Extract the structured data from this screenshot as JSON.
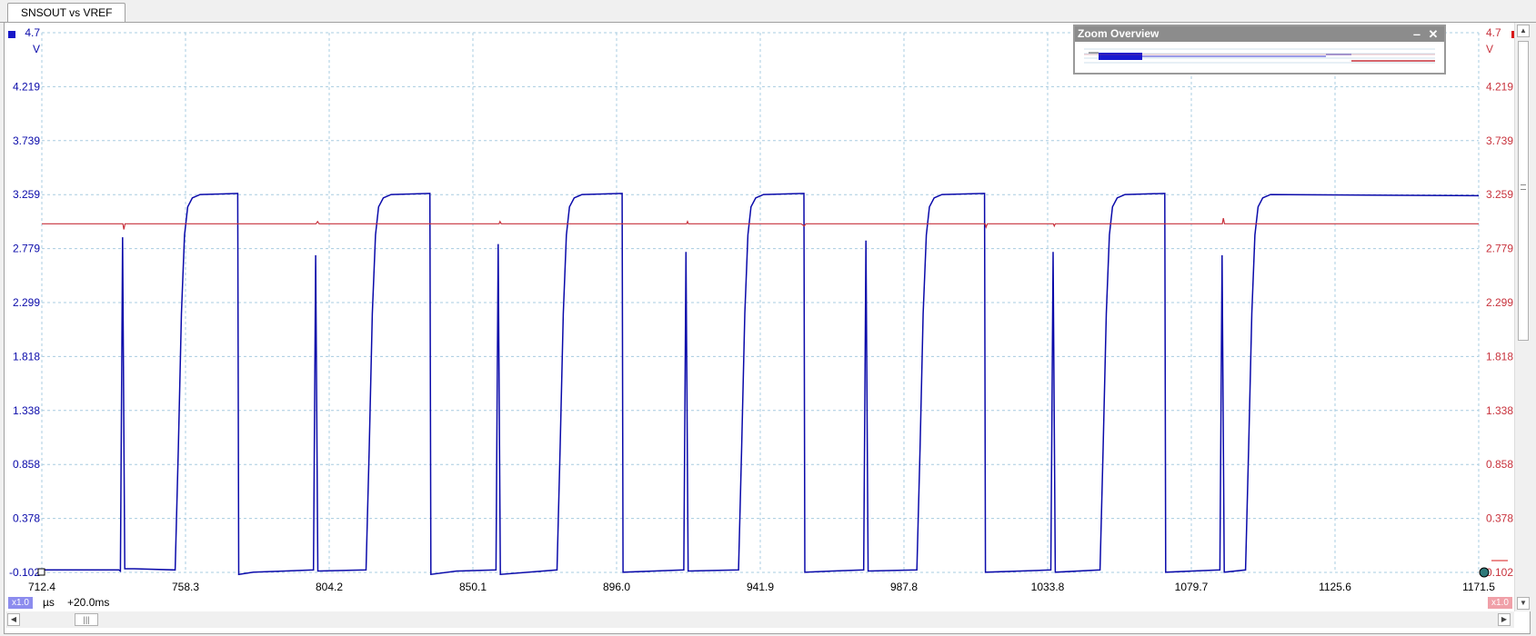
{
  "tab": {
    "label": "SNSOUT vs VREF"
  },
  "zoom_overview": {
    "title": "Zoom Overview",
    "minimize_label": "‒",
    "close_label": "✕"
  },
  "footer": {
    "left_multiplier": "x1.0",
    "right_multiplier": "x1.0",
    "time_unit": "µs",
    "time_offset": "+20.0ms"
  },
  "colors": {
    "blue": "#0a0aaa",
    "red": "#c8323c",
    "grid": "#a8cce0"
  },
  "chart_data": {
    "type": "line",
    "title": "",
    "xlabel": "µs",
    "ylabel": "V",
    "xlim": [
      712.4,
      1171.5
    ],
    "ylim": [
      -0.102,
      4.7
    ],
    "x_ticks": [
      "712.4",
      "758.3",
      "804.2",
      "850.1",
      "896.0",
      "941.9",
      "987.8",
      "1033.8",
      "1079.7",
      "1125.6",
      "1171.5"
    ],
    "y_ticks_left": [
      "4.7",
      "4.219",
      "3.739",
      "3.259",
      "2.779",
      "2.299",
      "1.818",
      "1.338",
      "0.858",
      "0.378",
      "-0.102"
    ],
    "y_ticks_right": [
      "4.7",
      "4.219",
      "3.739",
      "3.259",
      "2.779",
      "2.299",
      "1.818",
      "1.338",
      "0.858",
      "0.378",
      "0.102"
    ],
    "y_unit_left": "V",
    "y_unit_right": "V",
    "grid": true,
    "series": [
      {
        "name": "SNSOUT",
        "color": "#0a0aaa",
        "points": [
          [
            712.4,
            -0.08
          ],
          [
            737.0,
            -0.08
          ],
          [
            737.5,
            -0.09
          ],
          [
            738.2,
            2.88
          ],
          [
            738.9,
            -0.07
          ],
          [
            742.0,
            -0.07
          ],
          [
            755.0,
            -0.08
          ],
          [
            756.0,
            1.0
          ],
          [
            757.0,
            2.2
          ],
          [
            758.0,
            2.9
          ],
          [
            759.0,
            3.15
          ],
          [
            760.5,
            3.23
          ],
          [
            763.0,
            3.26
          ],
          [
            775.0,
            3.27
          ],
          [
            775.3,
            -0.12
          ],
          [
            780.0,
            -0.1
          ],
          [
            790.0,
            -0.09
          ],
          [
            799.2,
            -0.08
          ],
          [
            799.9,
            2.72
          ],
          [
            800.6,
            -0.09
          ],
          [
            816.0,
            -0.08
          ],
          [
            817.0,
            1.0
          ],
          [
            818.0,
            2.2
          ],
          [
            819.0,
            2.9
          ],
          [
            820.0,
            3.15
          ],
          [
            821.5,
            3.23
          ],
          [
            824.0,
            3.26
          ],
          [
            836.4,
            3.27
          ],
          [
            836.7,
            -0.12
          ],
          [
            845.0,
            -0.09
          ],
          [
            857.5,
            -0.08
          ],
          [
            858.2,
            2.82
          ],
          [
            858.9,
            -0.12
          ],
          [
            877.0,
            -0.08
          ],
          [
            878.0,
            1.0
          ],
          [
            879.0,
            2.2
          ],
          [
            880.0,
            2.9
          ],
          [
            881.0,
            3.15
          ],
          [
            882.5,
            3.23
          ],
          [
            885.0,
            3.26
          ],
          [
            897.8,
            3.27
          ],
          [
            898.1,
            -0.1
          ],
          [
            908.0,
            -0.09
          ],
          [
            917.5,
            -0.08
          ],
          [
            918.2,
            2.75
          ],
          [
            918.9,
            -0.09
          ],
          [
            935.0,
            -0.08
          ],
          [
            936.0,
            1.0
          ],
          [
            937.0,
            2.2
          ],
          [
            938.0,
            2.9
          ],
          [
            939.0,
            3.15
          ],
          [
            940.5,
            3.23
          ],
          [
            943.0,
            3.26
          ],
          [
            955.9,
            3.27
          ],
          [
            956.2,
            -0.1
          ],
          [
            965.0,
            -0.09
          ],
          [
            975.0,
            -0.08
          ],
          [
            975.7,
            2.85
          ],
          [
            976.4,
            -0.09
          ],
          [
            992.0,
            -0.08
          ],
          [
            993.0,
            1.0
          ],
          [
            994.0,
            2.2
          ],
          [
            995.0,
            2.9
          ],
          [
            996.0,
            3.15
          ],
          [
            997.5,
            3.23
          ],
          [
            1000.0,
            3.26
          ],
          [
            1013.6,
            3.27
          ],
          [
            1013.9,
            -0.1
          ],
          [
            1025.0,
            -0.09
          ],
          [
            1034.8,
            -0.08
          ],
          [
            1035.5,
            2.75
          ],
          [
            1036.2,
            -0.1
          ],
          [
            1050.5,
            -0.08
          ],
          [
            1051.5,
            1.0
          ],
          [
            1052.5,
            2.2
          ],
          [
            1053.5,
            2.9
          ],
          [
            1054.5,
            3.15
          ],
          [
            1056.0,
            3.23
          ],
          [
            1058.5,
            3.26
          ],
          [
            1071.2,
            3.27
          ],
          [
            1071.5,
            -0.1
          ],
          [
            1080.0,
            -0.09
          ],
          [
            1088.8,
            -0.08
          ],
          [
            1089.5,
            2.72
          ],
          [
            1090.2,
            -0.1
          ],
          [
            1097.0,
            -0.08
          ],
          [
            1098.0,
            1.0
          ],
          [
            1099.0,
            2.2
          ],
          [
            1100.0,
            2.9
          ],
          [
            1101.0,
            3.15
          ],
          [
            1102.5,
            3.23
          ],
          [
            1105.0,
            3.26
          ],
          [
            1171.5,
            3.25
          ]
        ]
      },
      {
        "name": "VREF",
        "color": "#c8323c",
        "points": [
          [
            712.4,
            3.0
          ],
          [
            720.0,
            3.0
          ],
          [
            738.3,
            3.0
          ],
          [
            738.6,
            2.95
          ],
          [
            739.0,
            3.0
          ],
          [
            760.0,
            3.0
          ],
          [
            775.0,
            3.0
          ],
          [
            790.0,
            3.0
          ],
          [
            800.0,
            3.0
          ],
          [
            800.5,
            3.02
          ],
          [
            801.0,
            3.0
          ],
          [
            830.0,
            3.0
          ],
          [
            858.5,
            3.0
          ],
          [
            858.8,
            3.02
          ],
          [
            859.2,
            3.0
          ],
          [
            918.4,
            3.0
          ],
          [
            918.7,
            3.02
          ],
          [
            919.0,
            3.0
          ],
          [
            955.0,
            3.0
          ],
          [
            956.0,
            2.98
          ],
          [
            956.5,
            3.0
          ],
          [
            980.0,
            3.0
          ],
          [
            1013.8,
            3.0
          ],
          [
            1014.1,
            2.97
          ],
          [
            1014.5,
            3.0
          ],
          [
            1035.6,
            3.0
          ],
          [
            1035.9,
            2.98
          ],
          [
            1036.2,
            3.0
          ],
          [
            1060.0,
            3.0
          ],
          [
            1089.6,
            3.0
          ],
          [
            1089.9,
            3.05
          ],
          [
            1090.3,
            3.0
          ],
          [
            1100.0,
            3.0
          ],
          [
            1110.0,
            3.0
          ],
          [
            1171.5,
            3.0
          ]
        ]
      }
    ]
  }
}
